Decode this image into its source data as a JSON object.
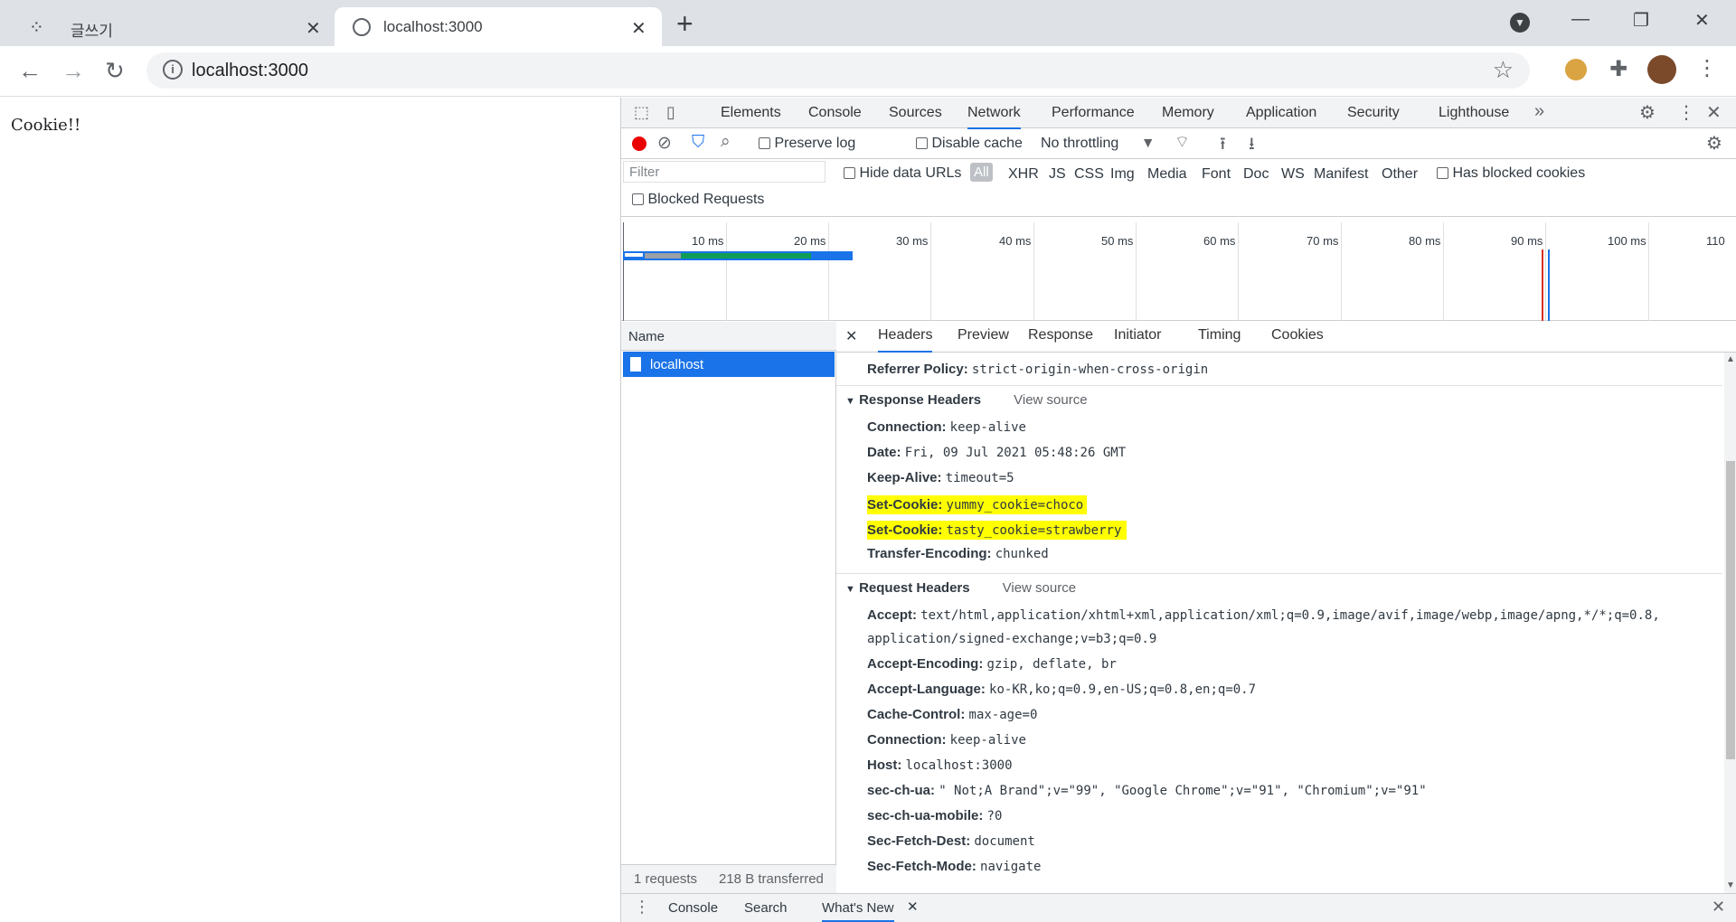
{
  "browser": {
    "tabs": [
      {
        "title": "글쓰기"
      },
      {
        "title": "localhost:3000"
      }
    ],
    "url": "localhost:3000"
  },
  "page": {
    "text": "Cookie!!"
  },
  "devtools": {
    "tabs": [
      "Elements",
      "Console",
      "Sources",
      "Network",
      "Performance",
      "Memory",
      "Application",
      "Security",
      "Lighthouse"
    ],
    "active_tab": "Network",
    "net_toolbar": {
      "preserve_log": "Preserve log",
      "disable_cache": "Disable cache",
      "throttling": "No throttling"
    },
    "filter": {
      "placeholder": "Filter",
      "hide_data_urls": "Hide data URLs",
      "types": [
        "All",
        "XHR",
        "JS",
        "CSS",
        "Img",
        "Media",
        "Font",
        "Doc",
        "WS",
        "Manifest",
        "Other"
      ],
      "has_blocked_cookies": "Has blocked cookies",
      "blocked_requests": "Blocked Requests"
    },
    "timeline_ticks": [
      "10 ms",
      "20 ms",
      "30 ms",
      "40 ms",
      "50 ms",
      "60 ms",
      "70 ms",
      "80 ms",
      "90 ms",
      "100 ms",
      "110"
    ],
    "requests": {
      "name_header": "Name",
      "items": [
        "localhost"
      ],
      "footer_count": "1 requests",
      "footer_transfer": "218 B transferred"
    },
    "detail_tabs": [
      "Headers",
      "Preview",
      "Response",
      "Initiator",
      "Timing",
      "Cookies"
    ],
    "referrer_policy": {
      "key": "Referrer Policy:",
      "value": "strict-origin-when-cross-origin"
    },
    "response_headers": {
      "title": "Response Headers",
      "view_source": "View source",
      "items": [
        {
          "key": "Connection:",
          "value": "keep-alive"
        },
        {
          "key": "Date:",
          "value": "Fri, 09 Jul 2021 05:48:26 GMT"
        },
        {
          "key": "Keep-Alive:",
          "value": "timeout=5"
        },
        {
          "key": "Set-Cookie:",
          "value": "yummy_cookie=choco"
        },
        {
          "key": "Set-Cookie:",
          "value": "tasty_cookie=strawberry"
        },
        {
          "key": "Transfer-Encoding:",
          "value": "chunked"
        }
      ]
    },
    "request_headers": {
      "title": "Request Headers",
      "view_source": "View source",
      "items": [
        {
          "key": "Accept:",
          "value": "text/html,application/xhtml+xml,application/xml;q=0.9,image/avif,image/webp,image/apng,*/*;q=0.8,",
          "cont": "application/signed-exchange;v=b3;q=0.9"
        },
        {
          "key": "Accept-Encoding:",
          "value": "gzip, deflate, br"
        },
        {
          "key": "Accept-Language:",
          "value": "ko-KR,ko;q=0.9,en-US;q=0.8,en;q=0.7"
        },
        {
          "key": "Cache-Control:",
          "value": "max-age=0"
        },
        {
          "key": "Connection:",
          "value": "keep-alive"
        },
        {
          "key": "Host:",
          "value": "localhost:3000"
        },
        {
          "key": "sec-ch-ua:",
          "value": "\" Not;A Brand\";v=\"99\", \"Google Chrome\";v=\"91\", \"Chromium\";v=\"91\""
        },
        {
          "key": "sec-ch-ua-mobile:",
          "value": "?0"
        },
        {
          "key": "Sec-Fetch-Dest:",
          "value": "document"
        },
        {
          "key": "Sec-Fetch-Mode:",
          "value": "navigate"
        }
      ]
    },
    "drawer": {
      "tabs": [
        "Console",
        "Search",
        "What's New"
      ]
    },
    "colors": {
      "accent": "#1a73e8",
      "highlight": "#ffff00",
      "record": "#d93025"
    }
  }
}
